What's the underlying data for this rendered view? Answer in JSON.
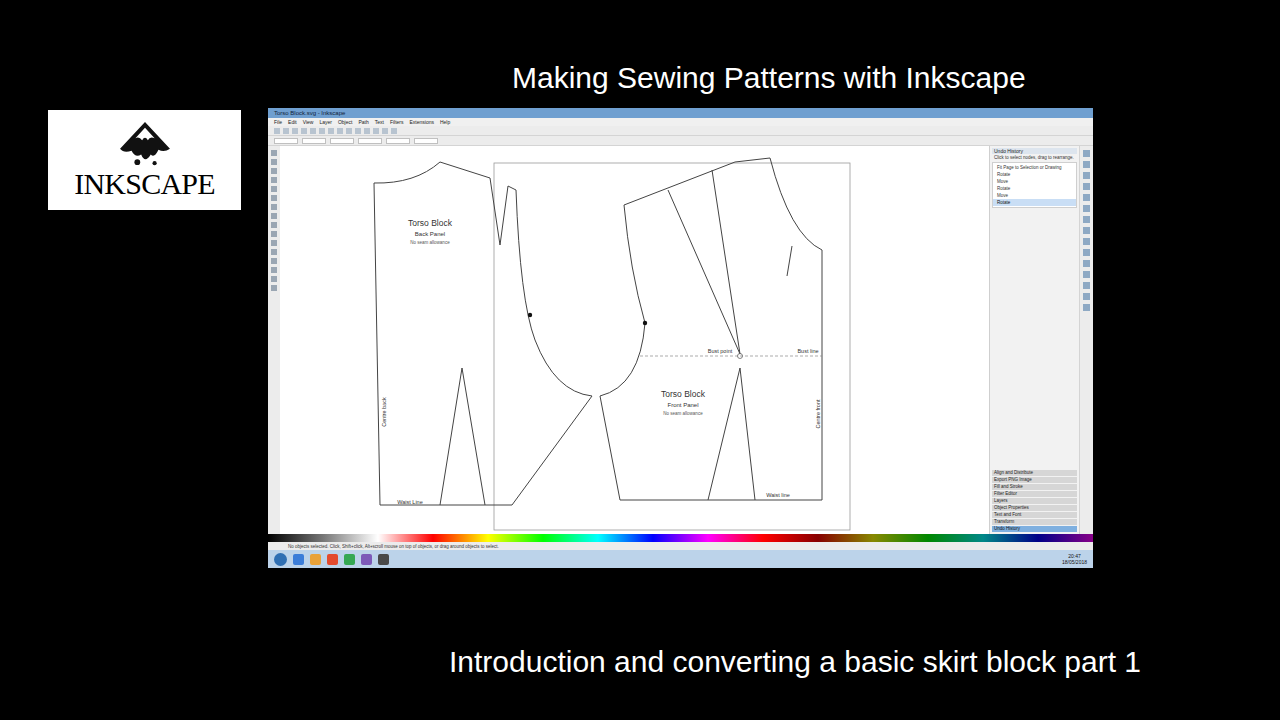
{
  "title": "Making Sewing Patterns with Inkscape",
  "subtitle": "Introduction and converting a basic skirt block part 1",
  "logo": {
    "text": "INKSCAPE"
  },
  "window": {
    "title": "Torso Block.svg - Inkscape"
  },
  "menu": [
    "File",
    "Edit",
    "View",
    "Layer",
    "Object",
    "Path",
    "Text",
    "Filters",
    "Extensions",
    "Help"
  ],
  "canvas": {
    "pieces": [
      {
        "title": "Torso Block",
        "subtitle": "Back Panel",
        "note": "No seam allowance",
        "edge": "Centre back",
        "waist": "Waist Line"
      },
      {
        "title": "Torso Block",
        "subtitle": "Front Panel",
        "note": "No seam allowance",
        "edge": "Centre front",
        "waist": "Waist line"
      }
    ],
    "bust_point": "Bust point",
    "bust_line": "Bust line"
  },
  "dock": {
    "title": "Undo History",
    "hint": "Click to select nodes, drag to rearrange.",
    "history": [
      {
        "label": "Fit Page to Selection or Drawing",
        "selected": false
      },
      {
        "label": "Rotate",
        "selected": false
      },
      {
        "label": "Move",
        "selected": false
      },
      {
        "label": "Rotate",
        "selected": false
      },
      {
        "label": "Move",
        "selected": false
      },
      {
        "label": "Rotate",
        "selected": true
      }
    ],
    "panels": [
      "Align and Distribute",
      "Export PNG Image",
      "Fill and Stroke",
      "Filter Editor",
      "Layers",
      "Object Properties",
      "Text and Font",
      "Transform",
      "Undo History"
    ]
  },
  "status": "No objects selected. Click, Shift+click, Alt+scroll mouse on top of objects, or drag around objects to select.",
  "taskbar": {
    "time": "20:47",
    "date": "18/05/2018"
  }
}
